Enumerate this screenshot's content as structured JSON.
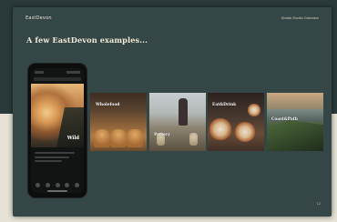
{
  "brand": "EastDevon",
  "header_right": "Global Studio Calendar",
  "heading": "A few EastDevon examples...",
  "phone": {
    "photo_label": "Wild"
  },
  "tiles": [
    {
      "label": "Wholefood"
    },
    {
      "label": "Pottery"
    },
    {
      "label": "Eat&Drink"
    },
    {
      "label": "Coast&Path"
    }
  ],
  "page_number": "12"
}
